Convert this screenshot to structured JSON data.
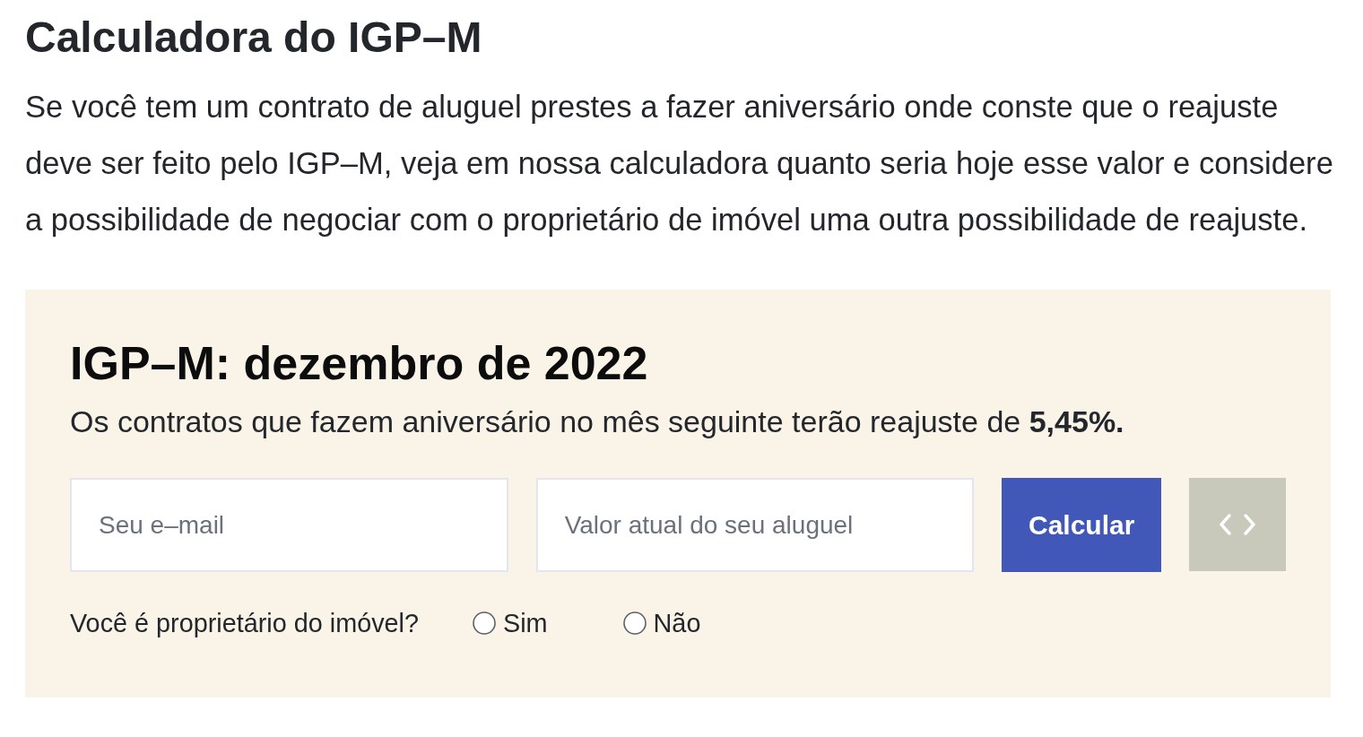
{
  "heading": "Calculadora do IGP–M",
  "intro": "Se você tem um contrato de aluguel prestes a fazer aniversário onde conste que o reajuste deve ser feito pelo IGP–M, veja em nossa calculadora quanto seria hoje esse valor e considere a possibilidade de negociar com o proprietário de imóvel uma outra possibilidade de reajuste.",
  "calculator": {
    "title": "IGP–M: dezembro de 2022",
    "summary": "Os contratos que fazem aniversário no mês seguinte terão reajuste de **5,45%.**",
    "fields": [
      {
        "placeholder": "Seu e–mail"
      },
      {
        "placeholder": "Valor atual do seu aluguel"
      }
    ],
    "submit_button": "Calcular",
    "owner_question": {
      "label": "Você é proprietário do imóvel?",
      "options": [
        {
          "label": "Sim",
          "selected": false
        },
        {
          "label": "Não",
          "selected": false
        }
      ]
    }
  }
}
